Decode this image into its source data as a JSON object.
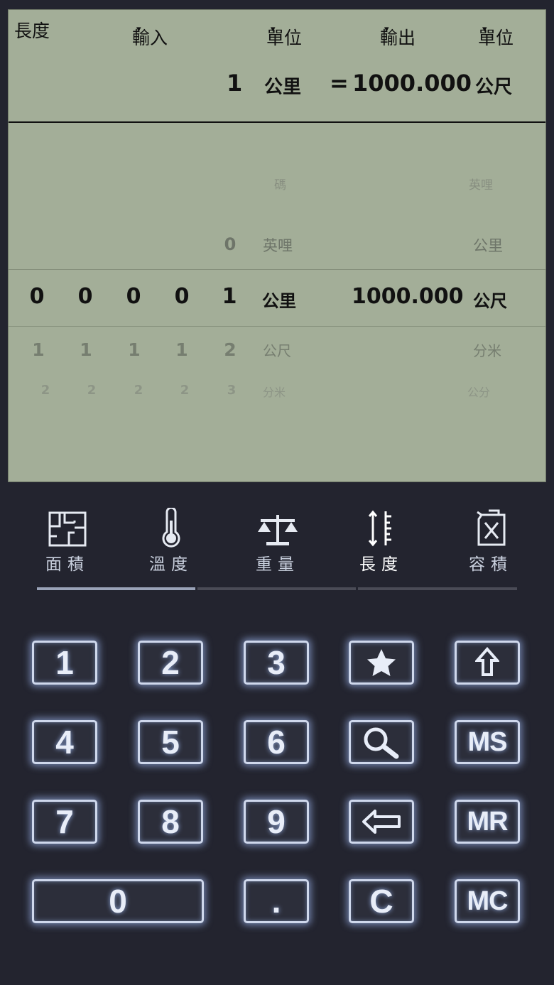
{
  "header": {
    "category": "長度",
    "input_label": "輸入",
    "unit_label_1": "單位",
    "output_label": "輸出",
    "unit_label_2": "單位",
    "caret": "▾"
  },
  "result": {
    "input_value": "1",
    "input_unit": "公里",
    "equals": "=",
    "output_value": "1000.000",
    "output_unit": "公尺"
  },
  "picker": {
    "faint_top": {
      "input_unit": "碼",
      "output_unit": "英哩"
    },
    "above": {
      "digit": "0",
      "input_unit": "英哩",
      "output_unit": "公里"
    },
    "selected": {
      "digits": [
        "0",
        "0",
        "0",
        "0",
        "1"
      ],
      "input_unit": "公里",
      "output_value": "1000.000",
      "output_unit": "公尺"
    },
    "below1": {
      "digits": [
        "1",
        "1",
        "1",
        "1",
        "2"
      ],
      "input_unit": "公尺",
      "output_unit": "分米"
    },
    "below2": {
      "digits": [
        "2",
        "2",
        "2",
        "2",
        "3"
      ],
      "input_unit": "分米",
      "output_unit": "公分"
    }
  },
  "tabs": [
    {
      "label": "面積",
      "icon": "floorplan-icon"
    },
    {
      "label": "溫度",
      "icon": "thermometer-icon"
    },
    {
      "label": "重量",
      "icon": "scale-icon"
    },
    {
      "label": "長度",
      "icon": "ruler-icon"
    },
    {
      "label": "容積",
      "icon": "jerrycan-icon"
    }
  ],
  "active_tab": "長度",
  "keypad": {
    "k1": "1",
    "k2": "2",
    "k3": "3",
    "k4": "4",
    "k5": "5",
    "k6": "6",
    "k7": "7",
    "k8": "8",
    "k9": "9",
    "k0": "0",
    "dot": ".",
    "clear": "C",
    "ms": "MS",
    "mr": "MR",
    "mc": "MC"
  },
  "colors": {
    "lcd": "#a3ae98",
    "background": "#23242f",
    "key_glow": "#cfd8ec"
  }
}
